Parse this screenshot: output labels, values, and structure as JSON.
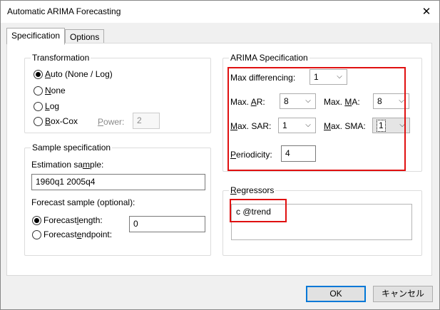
{
  "window": {
    "title": "Automatic ARIMA Forecasting",
    "close_glyph": "✕"
  },
  "tabs": [
    {
      "label": "Specification",
      "active": true
    },
    {
      "label": "Options",
      "active": false
    }
  ],
  "transformation": {
    "title": "Transformation",
    "options": [
      {
        "label_pre": "",
        "accel": "A",
        "label_post": "uto (None / Log)",
        "checked": true
      },
      {
        "label_pre": "",
        "accel": "N",
        "label_post": "one",
        "checked": false
      },
      {
        "label_pre": "",
        "accel": "L",
        "label_post": "og",
        "checked": false
      },
      {
        "label_pre": "",
        "accel": "B",
        "label_post": "ox-Cox",
        "checked": false
      }
    ],
    "power_label_accel": "P",
    "power_label_rest": "ower:",
    "power_value": "2"
  },
  "sample": {
    "title": "Sample specification",
    "estimation_label_pre": "Estimation sa",
    "estimation_label_accel": "m",
    "estimation_label_post": "ple:",
    "estimation_value": "1960q1 2005q4",
    "forecast_label": "Forecast sample (optional):",
    "forecast_options": [
      {
        "label_pre": "Forecast ",
        "accel": "l",
        "label_post": "ength:",
        "checked": true
      },
      {
        "label_pre": "Forecast ",
        "accel": "e",
        "label_post": "ndpoint:",
        "checked": false
      }
    ],
    "forecast_length_value": "0"
  },
  "arima": {
    "title": "ARIMA Specification",
    "max_diff_label": "Max differencing:",
    "max_diff_value": "1",
    "max_ar_pre": "Max. ",
    "max_ar_accel": "A",
    "max_ar_post": "R:",
    "max_ar_value": "8",
    "max_ma_pre": "Max. ",
    "max_ma_accel": "M",
    "max_ma_post": "A:",
    "max_ma_value": "8",
    "max_sar_pre": "",
    "max_sar_accel": "M",
    "max_sar_post": "ax. SAR:",
    "max_sar_value": "1",
    "max_sma_pre": "",
    "max_sma_accel": "M",
    "max_sma_post": "ax. SMA:",
    "max_sma_value": "1",
    "periodicity_pre": "",
    "periodicity_accel": "P",
    "periodicity_post": "eriodicity:",
    "periodicity_value": "4"
  },
  "regressors": {
    "title_accel": "R",
    "title_rest": "egressors",
    "value": "c @trend"
  },
  "buttons": {
    "ok": "OK",
    "cancel": "キャンセル"
  },
  "colors": {
    "highlight": "#e01010",
    "default_button": "#0078d7"
  }
}
